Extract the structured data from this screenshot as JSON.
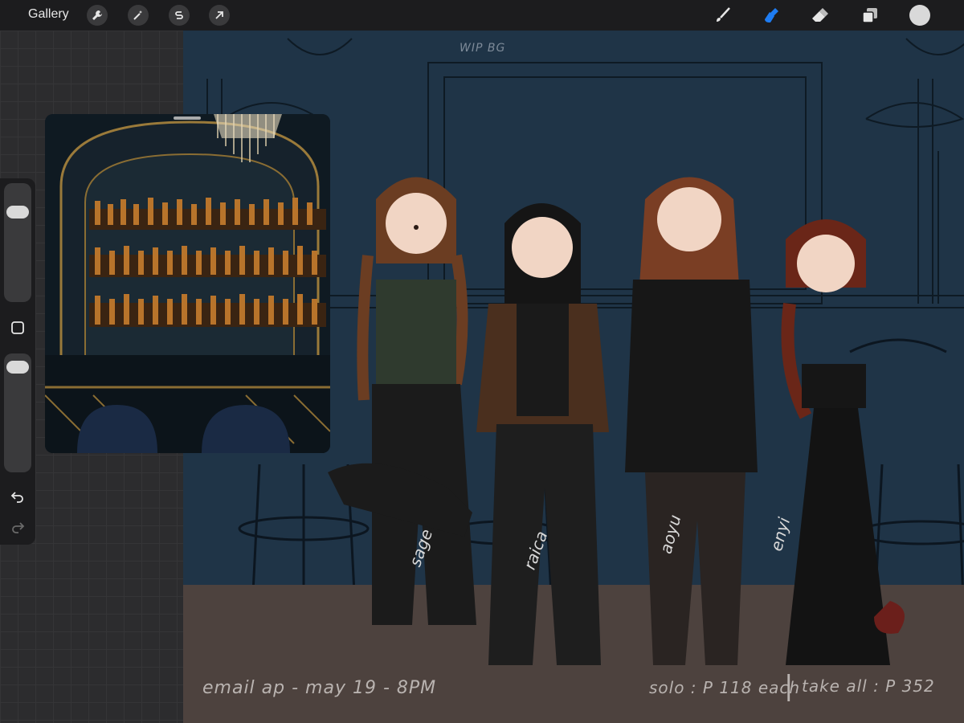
{
  "app": {
    "gallery_label": "Gallery"
  },
  "toolbar": {
    "left_tools": [
      "wrench-icon",
      "magic-wand-icon",
      "selection-s-icon",
      "arrow-transform-icon"
    ],
    "right_tools": [
      "brush-icon",
      "smudge-icon",
      "eraser-icon",
      "layers-icon",
      "color-swatch"
    ],
    "active_tool": "smudge-icon",
    "accent": "#1e7cf2",
    "current_color": "#d9d9d9"
  },
  "sidebar": {
    "brush_size_level": 0.8,
    "opacity_level": 0.95,
    "modify_button": "square-icon",
    "undo_icon": "undo-icon",
    "redo_icon": "redo-icon"
  },
  "canvas": {
    "wip_label": "WIP BG",
    "names": [
      "sage",
      "raica",
      "aoyu",
      "enyi"
    ],
    "footer_left": "email ap - may 19 - 8PM",
    "footer_right": "solo : P 118 each",
    "footer_divider": "|",
    "footer_all": "take all : P 352"
  },
  "colors": {
    "wall": "#1f3447",
    "floor": "#4d423e"
  }
}
